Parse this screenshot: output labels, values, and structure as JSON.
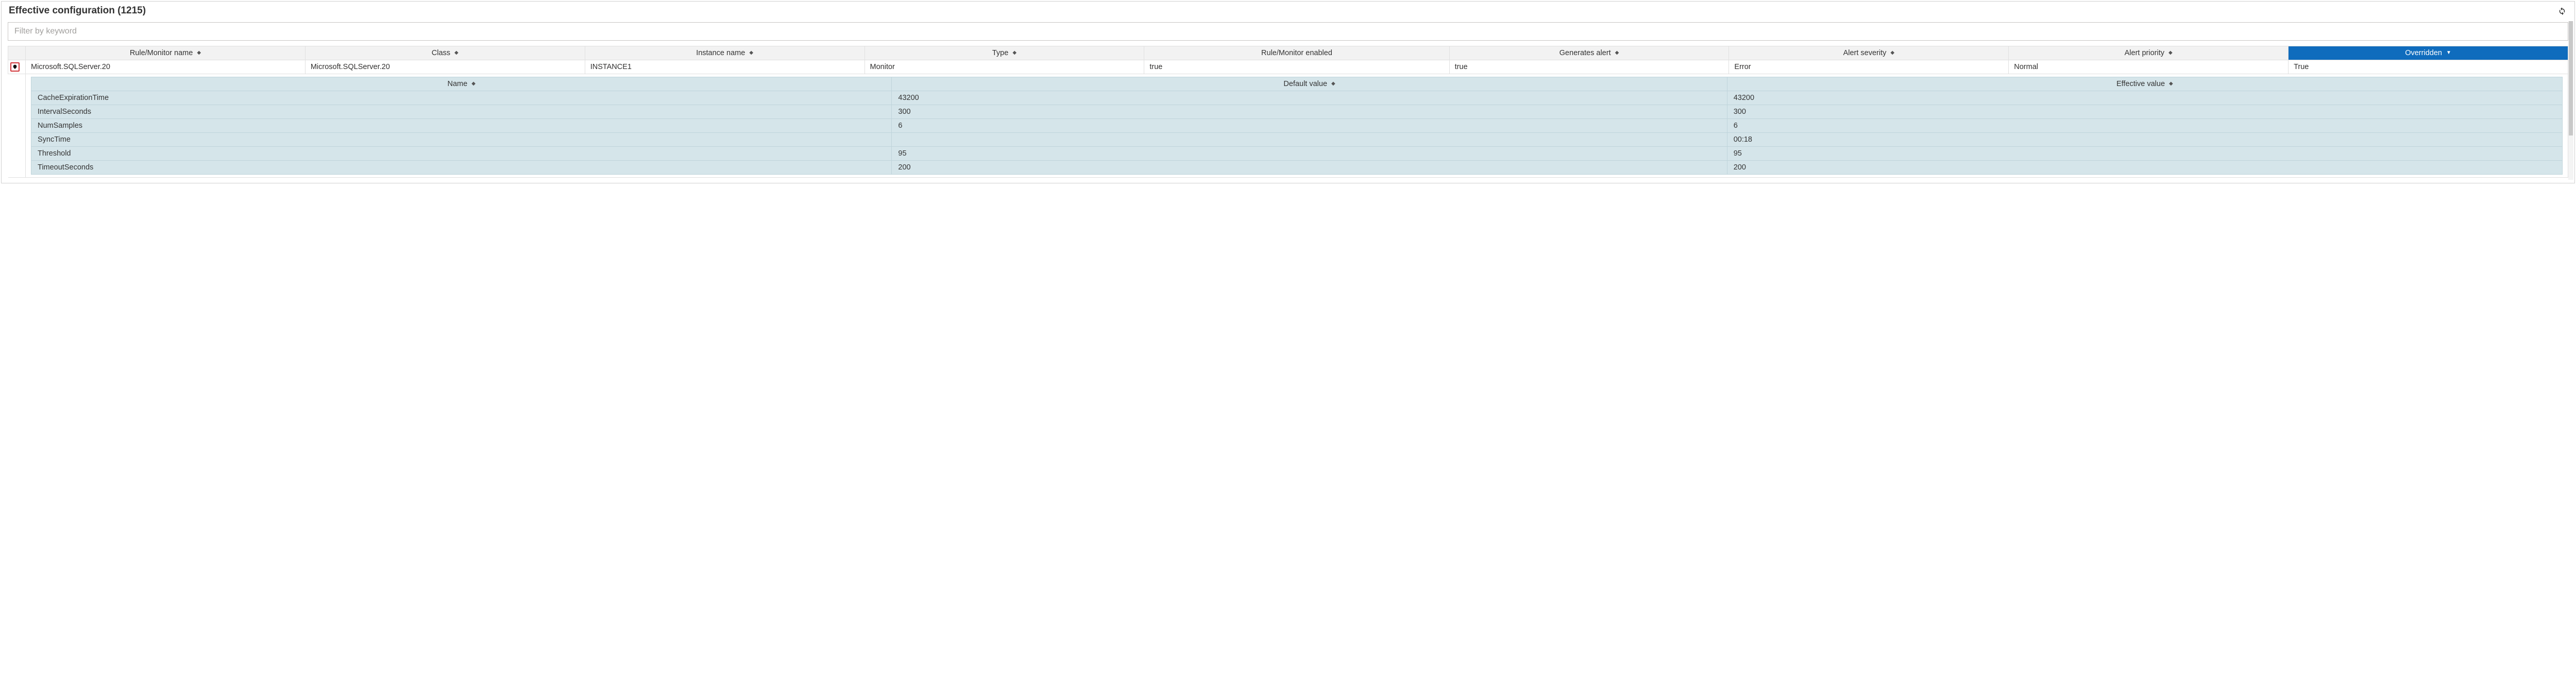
{
  "header": {
    "title": "Effective configuration (1215)",
    "refresh_aria": "Refresh"
  },
  "filter": {
    "placeholder": "Filter by keyword",
    "value": ""
  },
  "columns": {
    "rule_monitor_name": "Rule/Monitor name",
    "class": "Class",
    "instance_name": "Instance name",
    "type": "Type",
    "rule_monitor_enabled": "Rule/Monitor enabled",
    "generates_alert": "Generates alert",
    "alert_severity": "Alert severity",
    "alert_priority": "Alert priority",
    "overridden": "Overridden"
  },
  "rows": [
    {
      "rule_monitor_name": "Microsoft.SQLServer.20",
      "class": "Microsoft.SQLServer.20",
      "instance_name": "INSTANCE1",
      "type": "Monitor",
      "rule_monitor_enabled": "true",
      "generates_alert": "true",
      "alert_severity": "Error",
      "alert_priority": "Normal",
      "overridden": "True",
      "expanded": true,
      "details": {
        "headers": {
          "name": "Name",
          "default": "Default value",
          "effective": "Effective value"
        },
        "items": [
          {
            "name": "CacheExpirationTime",
            "default": "43200",
            "effective": "43200"
          },
          {
            "name": "IntervalSeconds",
            "default": "300",
            "effective": "300"
          },
          {
            "name": "NumSamples",
            "default": "6",
            "effective": "6"
          },
          {
            "name": "SyncTime",
            "default": "",
            "effective": "00:18"
          },
          {
            "name": "Threshold",
            "default": "95",
            "effective": "95"
          },
          {
            "name": "TimeoutSeconds",
            "default": "200",
            "effective": "200"
          }
        ]
      }
    }
  ]
}
